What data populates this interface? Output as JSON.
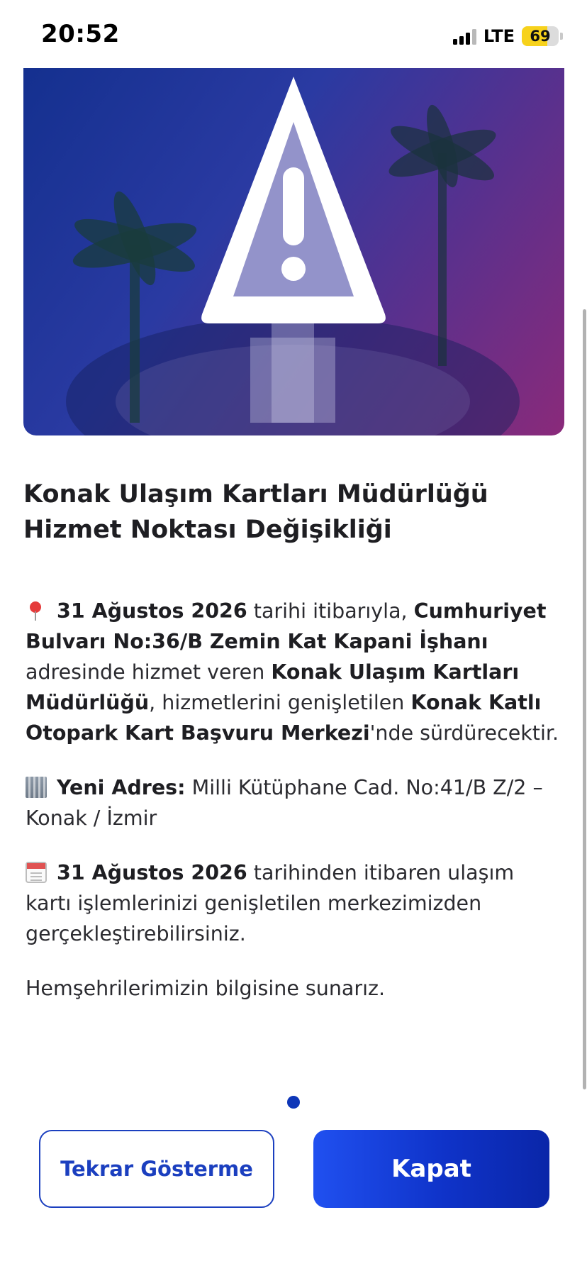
{
  "status_bar": {
    "time": "20:52",
    "network": "LTE",
    "battery": "69",
    "battery_level_percent": 69,
    "battery_color": "#f7d21c"
  },
  "hero": {
    "image_description_icon": "warning-triangle-icon",
    "background_colors": [
      "#14308f",
      "#8a2a7a"
    ]
  },
  "notice": {
    "title": "Konak Ulaşım Kartları Müdürlüğü Hizmet Noktası Değişikliği",
    "p1": {
      "icon": "pin-icon",
      "date": "31 Ağustos 2026",
      "t1": " tarihi itibarıyla, ",
      "old_address": "Cumhuriyet Bulvarı No:36/B Zemin Kat Kapani İşhanı",
      "t2": " adresinde hizmet veren ",
      "office": "Konak Ulaşım Kartları Müdürlüğü",
      "t3": ", hizmetlerini genişletilen ",
      "new_center": "Konak Katlı Otopark Kart Başvuru Merkezi",
      "t4": "'nde sürdürecektir."
    },
    "p2": {
      "icon": "building-icon",
      "label": "Yeni Adres:",
      "address": " Milli Kütüphane Cad. No:41/B Z/2 – Konak / İzmir"
    },
    "p3": {
      "icon": "calendar-icon",
      "date": "31 Ağustos 2026",
      "text": " tarihinden itibaren ulaşım kartı işlemlerinizi genişletilen merkezimizden gerçekleştirebilirsiniz."
    },
    "p4": "Hemşehrilerimizin bilgisine sunarız."
  },
  "pagination": {
    "current": 1,
    "total": 1,
    "color": "#0e36b8"
  },
  "buttons": {
    "dont_show_again": "Tekrar Gösterme",
    "close": "Kapat"
  },
  "colors": {
    "accent": "#1b3fbf",
    "text": "#1e1e22"
  }
}
